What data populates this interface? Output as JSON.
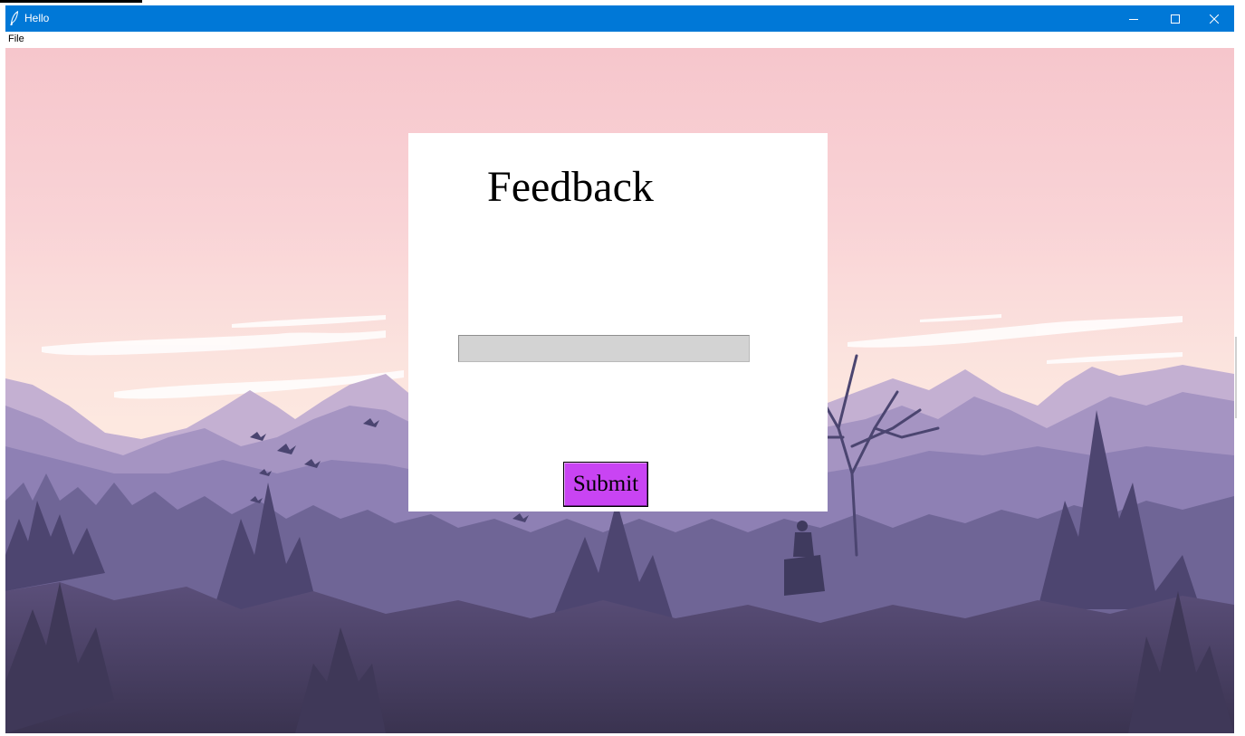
{
  "window": {
    "title": "Hello",
    "titlebar_color": "#0078d7",
    "icons": {
      "app": "feather-icon",
      "minimize": "minimize-icon",
      "maximize": "maximize-icon",
      "close": "close-icon"
    }
  },
  "menubar": {
    "items": [
      {
        "label": "File"
      }
    ]
  },
  "card": {
    "heading": "Feedback",
    "input_value": "",
    "input_placeholder": "",
    "submit_label": "Submit",
    "submit_color": "#c944f3"
  },
  "background": {
    "description_icon": "mountain-landscape-image"
  }
}
